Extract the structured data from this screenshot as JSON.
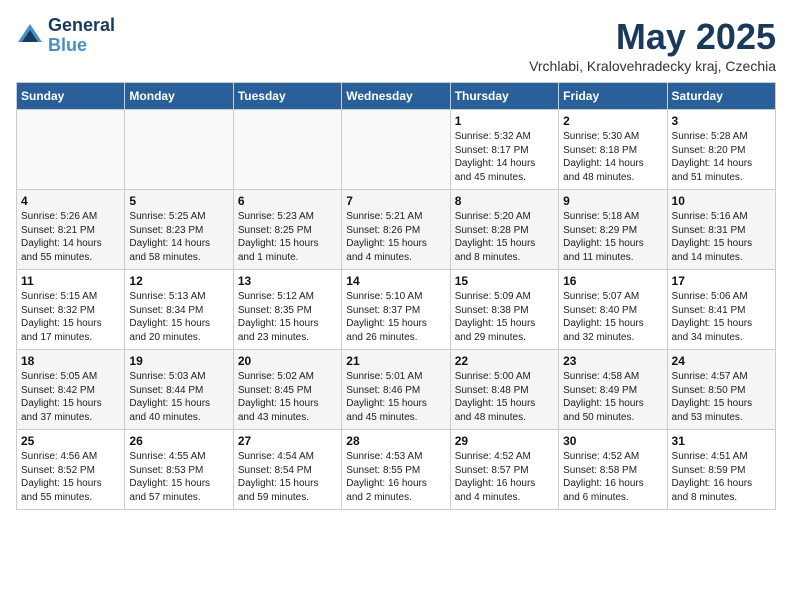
{
  "header": {
    "logo_line1": "General",
    "logo_line2": "Blue",
    "month": "May 2025",
    "location": "Vrchlabi, Kralovehradecky kraj, Czechia"
  },
  "days_of_week": [
    "Sunday",
    "Monday",
    "Tuesday",
    "Wednesday",
    "Thursday",
    "Friday",
    "Saturday"
  ],
  "weeks": [
    [
      {
        "day": "",
        "info": ""
      },
      {
        "day": "",
        "info": ""
      },
      {
        "day": "",
        "info": ""
      },
      {
        "day": "",
        "info": ""
      },
      {
        "day": "1",
        "info": "Sunrise: 5:32 AM\nSunset: 8:17 PM\nDaylight: 14 hours\nand 45 minutes."
      },
      {
        "day": "2",
        "info": "Sunrise: 5:30 AM\nSunset: 8:18 PM\nDaylight: 14 hours\nand 48 minutes."
      },
      {
        "day": "3",
        "info": "Sunrise: 5:28 AM\nSunset: 8:20 PM\nDaylight: 14 hours\nand 51 minutes."
      }
    ],
    [
      {
        "day": "4",
        "info": "Sunrise: 5:26 AM\nSunset: 8:21 PM\nDaylight: 14 hours\nand 55 minutes."
      },
      {
        "day": "5",
        "info": "Sunrise: 5:25 AM\nSunset: 8:23 PM\nDaylight: 14 hours\nand 58 minutes."
      },
      {
        "day": "6",
        "info": "Sunrise: 5:23 AM\nSunset: 8:25 PM\nDaylight: 15 hours\nand 1 minute."
      },
      {
        "day": "7",
        "info": "Sunrise: 5:21 AM\nSunset: 8:26 PM\nDaylight: 15 hours\nand 4 minutes."
      },
      {
        "day": "8",
        "info": "Sunrise: 5:20 AM\nSunset: 8:28 PM\nDaylight: 15 hours\nand 8 minutes."
      },
      {
        "day": "9",
        "info": "Sunrise: 5:18 AM\nSunset: 8:29 PM\nDaylight: 15 hours\nand 11 minutes."
      },
      {
        "day": "10",
        "info": "Sunrise: 5:16 AM\nSunset: 8:31 PM\nDaylight: 15 hours\nand 14 minutes."
      }
    ],
    [
      {
        "day": "11",
        "info": "Sunrise: 5:15 AM\nSunset: 8:32 PM\nDaylight: 15 hours\nand 17 minutes."
      },
      {
        "day": "12",
        "info": "Sunrise: 5:13 AM\nSunset: 8:34 PM\nDaylight: 15 hours\nand 20 minutes."
      },
      {
        "day": "13",
        "info": "Sunrise: 5:12 AM\nSunset: 8:35 PM\nDaylight: 15 hours\nand 23 minutes."
      },
      {
        "day": "14",
        "info": "Sunrise: 5:10 AM\nSunset: 8:37 PM\nDaylight: 15 hours\nand 26 minutes."
      },
      {
        "day": "15",
        "info": "Sunrise: 5:09 AM\nSunset: 8:38 PM\nDaylight: 15 hours\nand 29 minutes."
      },
      {
        "day": "16",
        "info": "Sunrise: 5:07 AM\nSunset: 8:40 PM\nDaylight: 15 hours\nand 32 minutes."
      },
      {
        "day": "17",
        "info": "Sunrise: 5:06 AM\nSunset: 8:41 PM\nDaylight: 15 hours\nand 34 minutes."
      }
    ],
    [
      {
        "day": "18",
        "info": "Sunrise: 5:05 AM\nSunset: 8:42 PM\nDaylight: 15 hours\nand 37 minutes."
      },
      {
        "day": "19",
        "info": "Sunrise: 5:03 AM\nSunset: 8:44 PM\nDaylight: 15 hours\nand 40 minutes."
      },
      {
        "day": "20",
        "info": "Sunrise: 5:02 AM\nSunset: 8:45 PM\nDaylight: 15 hours\nand 43 minutes."
      },
      {
        "day": "21",
        "info": "Sunrise: 5:01 AM\nSunset: 8:46 PM\nDaylight: 15 hours\nand 45 minutes."
      },
      {
        "day": "22",
        "info": "Sunrise: 5:00 AM\nSunset: 8:48 PM\nDaylight: 15 hours\nand 48 minutes."
      },
      {
        "day": "23",
        "info": "Sunrise: 4:58 AM\nSunset: 8:49 PM\nDaylight: 15 hours\nand 50 minutes."
      },
      {
        "day": "24",
        "info": "Sunrise: 4:57 AM\nSunset: 8:50 PM\nDaylight: 15 hours\nand 53 minutes."
      }
    ],
    [
      {
        "day": "25",
        "info": "Sunrise: 4:56 AM\nSunset: 8:52 PM\nDaylight: 15 hours\nand 55 minutes."
      },
      {
        "day": "26",
        "info": "Sunrise: 4:55 AM\nSunset: 8:53 PM\nDaylight: 15 hours\nand 57 minutes."
      },
      {
        "day": "27",
        "info": "Sunrise: 4:54 AM\nSunset: 8:54 PM\nDaylight: 15 hours\nand 59 minutes."
      },
      {
        "day": "28",
        "info": "Sunrise: 4:53 AM\nSunset: 8:55 PM\nDaylight: 16 hours\nand 2 minutes."
      },
      {
        "day": "29",
        "info": "Sunrise: 4:52 AM\nSunset: 8:57 PM\nDaylight: 16 hours\nand 4 minutes."
      },
      {
        "day": "30",
        "info": "Sunrise: 4:52 AM\nSunset: 8:58 PM\nDaylight: 16 hours\nand 6 minutes."
      },
      {
        "day": "31",
        "info": "Sunrise: 4:51 AM\nSunset: 8:59 PM\nDaylight: 16 hours\nand 8 minutes."
      }
    ]
  ]
}
